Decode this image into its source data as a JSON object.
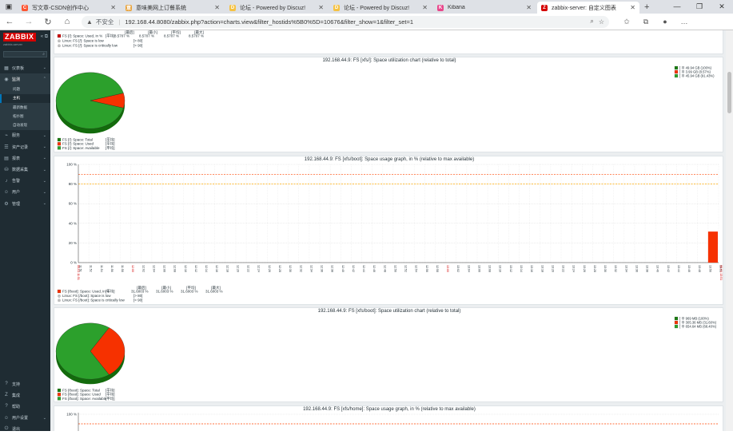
{
  "browser": {
    "tabs": [
      {
        "title": "写文章-CSDN创作中心",
        "fav_color": "#fc5531",
        "fav_glyph": "C"
      },
      {
        "title": "意味美网上订餐系统",
        "fav_color": "#e8a33d",
        "fav_glyph": "意"
      },
      {
        "title": "论坛 - Powered by Discuz!",
        "fav_color": "#f5c242",
        "fav_glyph": "D"
      },
      {
        "title": "论坛 - Powered by Discuz!",
        "fav_color": "#f5c242",
        "fav_glyph": "D"
      },
      {
        "title": "Kibana",
        "fav_color": "#e8478b",
        "fav_glyph": "K"
      },
      {
        "title": "zabbix-server: 自定义图表",
        "fav_color": "#d40000",
        "fav_glyph": "Z"
      }
    ],
    "active_tab": 5,
    "insecure_label": "不安全",
    "url": "192.168.44.8080/zabbix.php?action=charts.view&filter_hostids%5B0%5D=10676&filter_show=1&filter_set=1"
  },
  "sidebar": {
    "logo": "ZABBIX",
    "subtitle": "zabbix-server",
    "items": [
      {
        "label": "仪表板",
        "icon": "dashboard-icon",
        "glyph": "▦"
      },
      {
        "label": "监测",
        "icon": "monitoring-icon",
        "glyph": "◉",
        "open": true
      },
      {
        "label": "服务",
        "icon": "services-icon",
        "glyph": "⌁"
      },
      {
        "label": "资产记录",
        "icon": "inventory-icon",
        "glyph": "☰"
      },
      {
        "label": "报表",
        "icon": "reports-icon",
        "glyph": "▤"
      },
      {
        "label": "数据采集",
        "icon": "data-collection-icon",
        "glyph": "⛁"
      },
      {
        "label": "告警",
        "icon": "alerts-icon",
        "glyph": "♪"
      },
      {
        "label": "用户",
        "icon": "users-icon",
        "glyph": "☺"
      },
      {
        "label": "管理",
        "icon": "administration-icon",
        "glyph": "⚙"
      }
    ],
    "subitems": [
      "问题",
      "主机",
      "最新数据",
      "拓扑图",
      "自动发现"
    ],
    "selected_sub": 1,
    "bottom": [
      {
        "label": "支持",
        "icon": "support-icon",
        "glyph": "?"
      },
      {
        "label": "集成",
        "icon": "integrations-icon",
        "glyph": "Z"
      },
      {
        "label": "帮助",
        "icon": "help-icon",
        "glyph": "?"
      },
      {
        "label": "用户设置",
        "icon": "user-settings-icon",
        "glyph": "☺"
      },
      {
        "label": "退出",
        "icon": "signout-icon",
        "glyph": "⏻"
      }
    ]
  },
  "top_fragment": {
    "legend": [
      {
        "color": "#cc0000",
        "label": "FS [/]: Space: Used, in %",
        "flag": "[平均]",
        "values": [
          "8.5707 %",
          "8.5707 %",
          "8.5707 %",
          "8.5707 %"
        ]
      },
      {
        "color": "#ffffff",
        "label": "Linux: FS [/]: Space is low",
        "suffix": "[> 80]"
      },
      {
        "color": "#ffffff",
        "label": "Linux: FS [/]: Space is critically low",
        "suffix": "[> 90]"
      }
    ]
  },
  "pie1": {
    "title": "192.168.44.9: FS [xfs/]: Space utilization chart (relative to total)",
    "legend": [
      {
        "color": "#1a7c11",
        "label": "FS [/]: Space: Total",
        "flag": "[平均]"
      },
      {
        "color": "#f63100",
        "label": "FS [/]: Space: Used",
        "flag": "[平均]"
      },
      {
        "color": "#2ca02c",
        "label": "FS [/]: Space: Available",
        "flag": "[平均]"
      }
    ],
    "corner_legend": [
      {
        "color": "#1a7c11",
        "text": "[ 平 49.94 GB (100%)"
      },
      {
        "color": "#f63100",
        "text": "[ 平 3.99 GB (8.57%)"
      },
      {
        "color": "#2ca02c",
        "text": "[ 平 45.94 GB (91.43%)"
      }
    ]
  },
  "line1": {
    "title": "192.168.44.9: FS [xfs/boot]: Space usage graph, in % (relative to max available)",
    "legend": [
      {
        "color": "#f63100",
        "label": "FS [/boot]: Space: Used, in %",
        "flag": "[平均]",
        "values": [
          "31.6003 %",
          "31.6003 %",
          "31.6003 %",
          "31.6003 %"
        ]
      },
      {
        "color": "#ffffff",
        "label": "Linux: FS [/boot]: Space is low",
        "suffix": "[> 80]"
      },
      {
        "color": "#ffffff",
        "label": "Linux: FS [/boot]: Space is critically low",
        "suffix": "[> 90]"
      }
    ],
    "left_date": "06-01 11:51",
    "right_date": "06-01 13:51",
    "red_mark": "12:00",
    "second_red_mark": "13:00"
  },
  "pie2": {
    "title": "192.168.44.9: FS [xfs/boot]: Space utilization chart (relative to total)",
    "legend": [
      {
        "color": "#1a7c11",
        "label": "FS [/boot]: Space: Total",
        "flag": "[平均]"
      },
      {
        "color": "#f63100",
        "label": "FS [/boot]: Space: Used",
        "flag": "[平均]"
      },
      {
        "color": "#2ca02c",
        "label": "FS [/boot]: Space: Available",
        "flag": "[平均]"
      }
    ],
    "corner_legend": [
      {
        "color": "#1a7c11",
        "text": "[ 平 969 MB (100%)"
      },
      {
        "color": "#f63100",
        "text": "[ 平 305.36 MB (31.60%)"
      },
      {
        "color": "#2ca02c",
        "text": "[ 平 654.64 MB (68.40%)"
      }
    ]
  },
  "line2": {
    "title": "192.168.44.9: FS [xfs/home]: Space usage graph, in % (relative to max available)",
    "y_top_label": "100 %"
  },
  "chart_data": [
    {
      "type": "pie",
      "title": "192.168.44.9: FS [xfs/]: Space utilization chart (relative to total)",
      "slices": [
        {
          "name": "FS [/]: Space: Used",
          "value": 8.57,
          "color": "#f63100"
        },
        {
          "name": "FS [/]: Space: Available",
          "value": 91.43,
          "color": "#2ca02c"
        }
      ]
    },
    {
      "type": "bar",
      "title": "192.168.44.9: FS [xfs/boot]: Space usage graph, in % (relative to max available)",
      "ylim": [
        0,
        100
      ],
      "yticks": [
        "0 %",
        "20 %",
        "40 %",
        "60 %",
        "80 %",
        "100 %"
      ],
      "thresholds": [
        {
          "value": 80,
          "color": "#e0a080"
        },
        {
          "value": 90,
          "color": "#e0a080"
        }
      ],
      "x": [
        "11:51",
        "11:52",
        "11:54",
        "11:56",
        "11:58",
        "12:00",
        "12:02",
        "12:04",
        "12:06",
        "12:08",
        "12:10",
        "12:12",
        "12:14",
        "12:16",
        "12:18",
        "12:20",
        "12:22",
        "12:24",
        "12:26",
        "12:28",
        "12:30",
        "12:32",
        "12:34",
        "12:36",
        "12:38",
        "12:40",
        "12:42",
        "12:44",
        "12:46",
        "12:48",
        "12:50",
        "12:52",
        "12:54",
        "12:56",
        "12:58",
        "13:00",
        "13:02",
        "13:04",
        "13:06",
        "13:08",
        "13:10",
        "13:12",
        "13:14",
        "13:16",
        "13:18",
        "13:20",
        "13:22",
        "13:24",
        "13:26",
        "13:28",
        "13:30",
        "13:32",
        "13:34",
        "13:36",
        "13:38",
        "13:40",
        "13:42",
        "13:44",
        "13:46",
        "13:48",
        "13:50",
        "13:51"
      ],
      "series": [
        {
          "name": "FS [/boot]: Space: Used, in %",
          "data": [
            {
              "x": "13:50",
              "y": 31.6
            }
          ]
        }
      ]
    },
    {
      "type": "pie",
      "title": "192.168.44.9: FS [xfs/boot]: Space utilization chart (relative to total)",
      "slices": [
        {
          "name": "FS [/boot]: Space: Used",
          "value": 31.6,
          "color": "#f63100"
        },
        {
          "name": "FS [/boot]: Space: Available",
          "value": 68.4,
          "color": "#2ca02c"
        }
      ]
    }
  ]
}
